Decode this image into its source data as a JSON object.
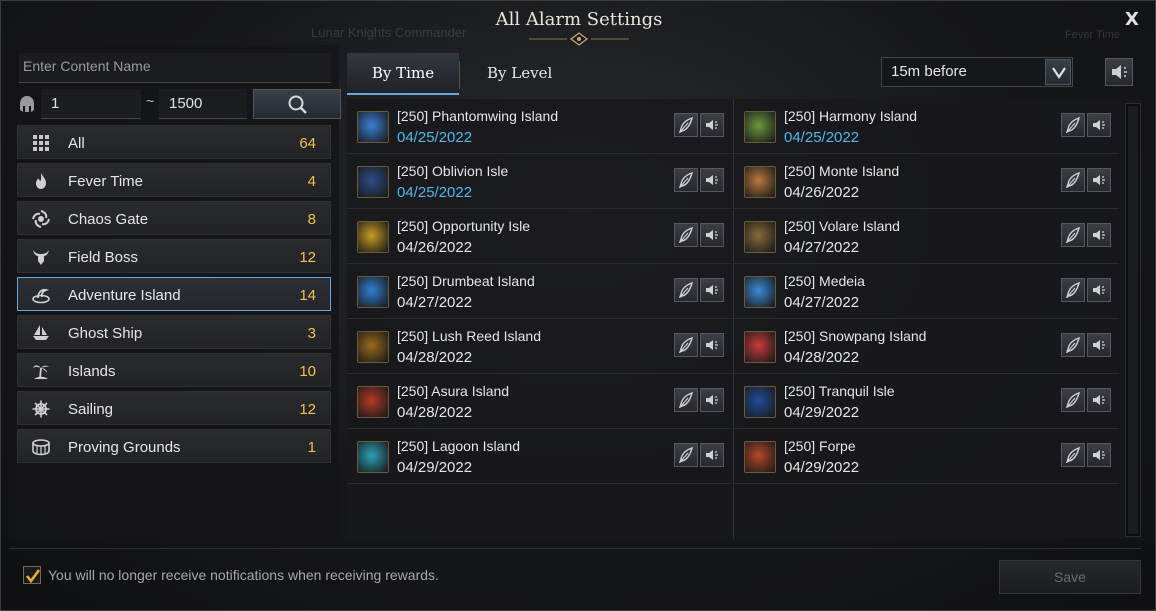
{
  "window": {
    "title": "All Alarm Settings",
    "close_label": "X",
    "background_texts": [
      "Lunar Knights Commander",
      "Fever Time"
    ]
  },
  "filters": {
    "name_placeholder": "Enter Content Name",
    "level_min": "1",
    "level_separator": "~",
    "level_max": "1500"
  },
  "categories": [
    {
      "label": "All",
      "count": "64",
      "icon": "grid-icon"
    },
    {
      "label": "Fever Time",
      "count": "4",
      "icon": "flame-icon"
    },
    {
      "label": "Chaos Gate",
      "count": "8",
      "icon": "vortex-icon"
    },
    {
      "label": "Field Boss",
      "count": "12",
      "icon": "horned-skull-icon"
    },
    {
      "label": "Adventure Island",
      "count": "14",
      "icon": "island-swirl-icon",
      "selected": true
    },
    {
      "label": "Ghost Ship",
      "count": "3",
      "icon": "ship-icon"
    },
    {
      "label": "Islands",
      "count": "10",
      "icon": "palm-tree-icon"
    },
    {
      "label": "Sailing",
      "count": "12",
      "icon": "ship-wheel-icon"
    },
    {
      "label": "Proving Grounds",
      "count": "1",
      "icon": "arena-icon"
    }
  ],
  "tabs": {
    "by_time": "By Time",
    "by_level": "By Level",
    "active": "by_time"
  },
  "timing": {
    "selected": "15m before"
  },
  "entries_left": [
    {
      "name": "[250] Phantomwing Island",
      "date": "04/25/2022",
      "highlight": true,
      "icon_color": "#3a7fd8"
    },
    {
      "name": "[250] Oblivion Isle",
      "date": "04/25/2022",
      "highlight": true,
      "icon_color": "#2d4c86"
    },
    {
      "name": "[250] Opportunity Isle",
      "date": "04/26/2022",
      "highlight": false,
      "icon_color": "#c89a22"
    },
    {
      "name": "[250] Drumbeat Island",
      "date": "04/27/2022",
      "highlight": false,
      "icon_color": "#2f7fd4"
    },
    {
      "name": "[250] Lush Reed Island",
      "date": "04/28/2022",
      "highlight": false,
      "icon_color": "#9a6a1c"
    },
    {
      "name": "[250] Asura Island",
      "date": "04/28/2022",
      "highlight": false,
      "icon_color": "#b23a22"
    },
    {
      "name": "[250] Lagoon Island",
      "date": "04/29/2022",
      "highlight": false,
      "icon_color": "#2ca0b8"
    }
  ],
  "entries_right": [
    {
      "name": "[250] Harmony Island",
      "date": "04/25/2022",
      "highlight": true,
      "icon_color": "#6a9a3a"
    },
    {
      "name": "[250] Monte Island",
      "date": "04/26/2022",
      "highlight": false,
      "icon_color": "#b87a3a"
    },
    {
      "name": "[250] Volare Island",
      "date": "04/27/2022",
      "highlight": false,
      "icon_color": "#8a6a3a"
    },
    {
      "name": "[250] Medeia",
      "date": "04/27/2022",
      "highlight": false,
      "icon_color": "#3a8ad8"
    },
    {
      "name": "[250] Snowpang Island",
      "date": "04/28/2022",
      "highlight": false,
      "icon_color": "#c83a3a"
    },
    {
      "name": "[250] Tranquil Isle",
      "date": "04/29/2022",
      "highlight": false,
      "icon_color": "#1e4e9a"
    },
    {
      "name": "[250] Forpe",
      "date": "04/29/2022",
      "highlight": false,
      "icon_color": "#b8462a"
    }
  ],
  "footer": {
    "checkbox_checked": true,
    "notice": "You will no longer receive notifications when receiving rewards.",
    "save_label": "Save"
  },
  "colors": {
    "count": "#f2c14a",
    "date_highlight": "#4fb8ee",
    "selection_border": "#6aa7d8"
  }
}
